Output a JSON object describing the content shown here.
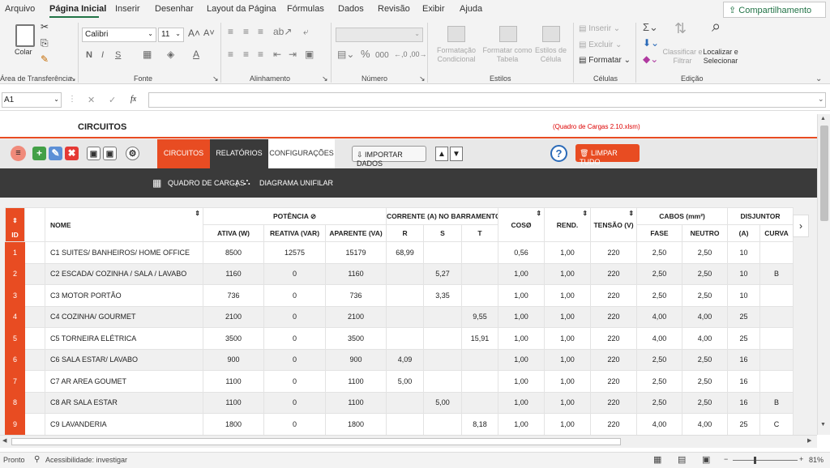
{
  "menu": [
    "Arquivo",
    "Página Inicial",
    "Inserir",
    "Desenhar",
    "Layout da Página",
    "Fórmulas",
    "Dados",
    "Revisão",
    "Exibir",
    "Ajuda"
  ],
  "share_label": "Compartilhamento",
  "ribbon": {
    "paste": "Colar",
    "clipboard_label": "Área de Transferência",
    "font_name": "Calibri",
    "font_size": "11",
    "font_label": "Fonte",
    "align_label": "Alinhamento",
    "number_label": "Número",
    "cond_format": "Formatação Condicional",
    "format_table": "Formatar como Tabela",
    "cell_styles": "Estilos de Célula",
    "styles_label": "Estilos",
    "insert": "Inserir",
    "delete": "Excluir",
    "format": "Formatar",
    "cells_label": "Células",
    "sort_filter": "Classificar e Filtrar",
    "find_select": "Localizar e Selecionar",
    "edit_label": "Edição"
  },
  "formula": {
    "cell_ref": "A1",
    "fx": "fx"
  },
  "sheet": {
    "title": "CIRCUITOS",
    "file_label": "(Quadro de Cargas 2.10.xlsm)",
    "tabs": [
      "CIRCUITOS",
      "RELATÓRIOS",
      "CONFIGURAÇÕES"
    ],
    "import_label": "IMPORTAR DADOS",
    "clear_label": "LIMPAR TUDO",
    "help": "?",
    "sub1": "QUADRO DE CARGAS",
    "sub_sep": "|",
    "sub2": "DIAGRAMA UNIFILAR"
  },
  "table": {
    "group_headers": {
      "potencia": "POTÊNCIA",
      "corrente": "CORRENTE (A) NO BARRAMENTO",
      "cabos": "CABOS (mm²)",
      "disjuntor": "DISJUNTOR"
    },
    "headers": {
      "id": "ID",
      "nome": "NOME",
      "ativa": "ATIVA (W)",
      "reativa": "REATIVA (VAR)",
      "aparente": "APARENTE (VA)",
      "r": "R",
      "s": "S",
      "t": "T",
      "cos": "COSØ",
      "rend": "REND.",
      "tensao": "TENSÃO (V)",
      "fase": "FASE",
      "neutro": "NEUTRO",
      "a": "(A)",
      "curva": "CURVA"
    },
    "rows": [
      [
        "1",
        "C1 SUITES/ BANHEIROS/ HOME OFFICE",
        "8500",
        "12575",
        "15179",
        "68,99",
        "",
        "",
        "0,56",
        "1,00",
        "220",
        "2,50",
        "2,50",
        "10",
        ""
      ],
      [
        "2",
        "C2 ESCADA/ COZINHA / SALA / LAVABO",
        "1160",
        "0",
        "1160",
        "",
        "5,27",
        "",
        "1,00",
        "1,00",
        "220",
        "2,50",
        "2,50",
        "10",
        "B"
      ],
      [
        "3",
        "C3 MOTOR PORTÃO",
        "736",
        "0",
        "736",
        "",
        "3,35",
        "",
        "1,00",
        "1,00",
        "220",
        "2,50",
        "2,50",
        "10",
        ""
      ],
      [
        "4",
        "C4 COZINHA/ GOURMET",
        "2100",
        "0",
        "2100",
        "",
        "",
        "9,55",
        "1,00",
        "1,00",
        "220",
        "4,00",
        "4,00",
        "25",
        ""
      ],
      [
        "5",
        "C5 TORNEIRA ELÉTRICA",
        "3500",
        "0",
        "3500",
        "",
        "",
        "15,91",
        "1,00",
        "1,00",
        "220",
        "4,00",
        "4,00",
        "25",
        ""
      ],
      [
        "6",
        "C6 SALA ESTAR/ LAVABO",
        "900",
        "0",
        "900",
        "4,09",
        "",
        "",
        "1,00",
        "1,00",
        "220",
        "2,50",
        "2,50",
        "16",
        ""
      ],
      [
        "7",
        "C7 AR AREA GOUMET",
        "1100",
        "0",
        "1100",
        "5,00",
        "",
        "",
        "1,00",
        "1,00",
        "220",
        "2,50",
        "2,50",
        "16",
        ""
      ],
      [
        "8",
        "C8 AR SALA ESTAR",
        "1100",
        "0",
        "1100",
        "",
        "5,00",
        "",
        "1,00",
        "1,00",
        "220",
        "2,50",
        "2,50",
        "16",
        "B"
      ],
      [
        "9",
        "C9 LAVANDERIA",
        "1800",
        "0",
        "1800",
        "",
        "",
        "8,18",
        "1,00",
        "1,00",
        "220",
        "4,00",
        "4,00",
        "25",
        "C"
      ]
    ]
  },
  "status": {
    "ready": "Pronto",
    "accessibility": "Acessibilidade: investigar",
    "zoom": "81%"
  },
  "colors": {
    "accent": "#e84c22",
    "excel_green": "#217346",
    "dark_bar": "#3a3a3a"
  }
}
